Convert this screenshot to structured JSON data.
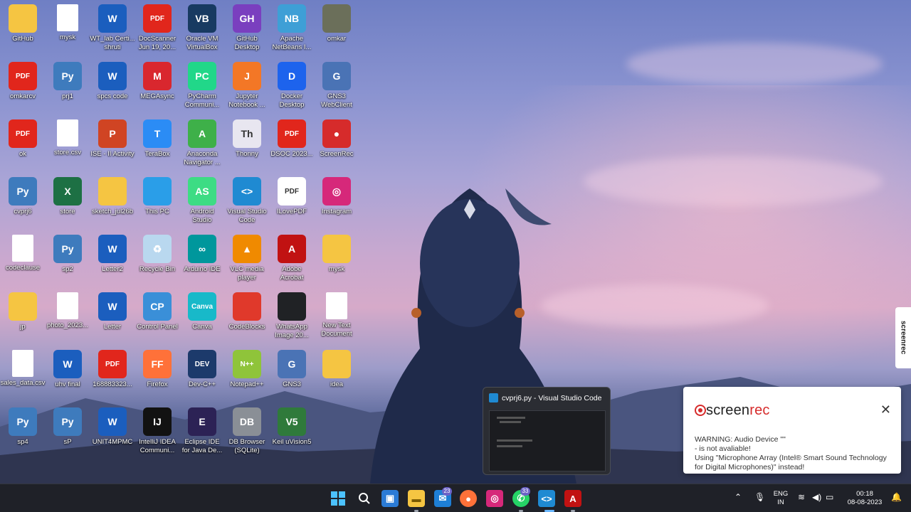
{
  "desktop": {
    "icons": [
      {
        "label": "GitHub",
        "glyph": "",
        "bg": "#f5c542",
        "icon": "folder-icon"
      },
      {
        "label": "mysk",
        "glyph": "",
        "bg": "#ffffff",
        "icon": "blank-file-icon"
      },
      {
        "label": "WT_lab Certi...\nshruti",
        "glyph": "W",
        "bg": "#1b5ebe",
        "icon": "word-icon"
      },
      {
        "label": "DocScanner\nJun 19, 20...",
        "glyph": "PDF",
        "bg": "#e1261c",
        "icon": "pdf-icon"
      },
      {
        "label": "Oracle VM\nVirtualBox",
        "glyph": "VB",
        "bg": "#183a61",
        "icon": "virtualbox-icon"
      },
      {
        "label": "GitHub\nDesktop",
        "glyph": "GH",
        "bg": "#7a3fbf",
        "icon": "github-desktop-icon"
      },
      {
        "label": "Apache\nNetBeans I...",
        "glyph": "NB",
        "bg": "#3e9fd6",
        "icon": "netbeans-icon"
      },
      {
        "label": "omkar",
        "glyph": "",
        "bg": "#6b6f5a",
        "icon": "photo-icon"
      },
      {
        "label": "omkarcv",
        "glyph": "PDF",
        "bg": "#e1261c",
        "icon": "pdf-icon"
      },
      {
        "label": "prj1",
        "glyph": "Py",
        "bg": "#3e7bbd",
        "icon": "python-file-icon"
      },
      {
        "label": "spcs code",
        "glyph": "W",
        "bg": "#1b5ebe",
        "icon": "word-icon"
      },
      {
        "label": "MEGAsync",
        "glyph": "M",
        "bg": "#d9272e",
        "icon": "mega-icon"
      },
      {
        "label": "PyCharm\nCommuni...",
        "glyph": "PC",
        "bg": "#21d789",
        "icon": "pycharm-icon"
      },
      {
        "label": "Jupyter\nNotebook ...",
        "glyph": "J",
        "bg": "#f37726",
        "icon": "jupyter-icon"
      },
      {
        "label": "Docker\nDesktop",
        "glyph": "D",
        "bg": "#1d63ed",
        "icon": "docker-icon"
      },
      {
        "label": "GNS3\nWebClient",
        "glyph": "G",
        "bg": "#4a73b5",
        "icon": "gns3-icon"
      },
      {
        "label": "ok",
        "glyph": "PDF",
        "bg": "#e1261c",
        "icon": "pdf-icon"
      },
      {
        "label": "store.csv",
        "glyph": "",
        "bg": "#ffffff",
        "icon": "text-file-icon"
      },
      {
        "label": "ISE - II Activity",
        "glyph": "P",
        "bg": "#d04423",
        "icon": "powerpoint-icon"
      },
      {
        "label": "TeraBox",
        "glyph": "T",
        "bg": "#2b8cf5",
        "icon": "terabox-icon"
      },
      {
        "label": "Anaconda\nNavigator ...",
        "glyph": "A",
        "bg": "#3eb049",
        "icon": "anaconda-icon"
      },
      {
        "label": "Thonny",
        "glyph": "Th",
        "bg": "#e8e6f0",
        "icon": "thonny-icon"
      },
      {
        "label": "DSOC 2023...",
        "glyph": "PDF",
        "bg": "#e1261c",
        "icon": "pdf-icon"
      },
      {
        "label": "ScreenRec",
        "glyph": "●",
        "bg": "#d62b2b",
        "icon": "screenrec-icon"
      },
      {
        "label": "cvprj6",
        "glyph": "Py",
        "bg": "#3e7bbd",
        "icon": "python-file-icon"
      },
      {
        "label": "store",
        "glyph": "X",
        "bg": "#1d7044",
        "icon": "excel-icon"
      },
      {
        "label": "sketch_jul26b",
        "glyph": "",
        "bg": "#f5c542",
        "icon": "folder-icon"
      },
      {
        "label": "This PC",
        "glyph": "",
        "bg": "#2a9ee8",
        "icon": "monitor-icon"
      },
      {
        "label": "Android\nStudio",
        "glyph": "AS",
        "bg": "#3ddc84",
        "icon": "android-studio-icon"
      },
      {
        "label": "Visual Studio\nCode",
        "glyph": "<>",
        "bg": "#1f8ad2",
        "icon": "vscode-icon"
      },
      {
        "label": "ILovePDF",
        "glyph": "PDF",
        "bg": "#ffffff",
        "icon": "ilovepdf-icon"
      },
      {
        "label": "Instagram",
        "glyph": "◎",
        "bg": "#d6287a",
        "icon": "instagram-icon"
      },
      {
        "label": "codeclause",
        "glyph": "",
        "bg": "#ffffff",
        "icon": "document-icon"
      },
      {
        "label": "sp2",
        "glyph": "Py",
        "bg": "#3e7bbd",
        "icon": "python-file-icon"
      },
      {
        "label": "Letter2",
        "glyph": "W",
        "bg": "#1b5ebe",
        "icon": "word-icon"
      },
      {
        "label": "Recycle Bin",
        "glyph": "♻",
        "bg": "#b9d8ef",
        "icon": "recycle-bin-icon"
      },
      {
        "label": "Arduino IDE",
        "glyph": "∞",
        "bg": "#00979c",
        "icon": "arduino-icon"
      },
      {
        "label": "VLC media\nplayer",
        "glyph": "▲",
        "bg": "#f08a00",
        "icon": "vlc-icon"
      },
      {
        "label": "Adobe\nAcrobat",
        "glyph": "A",
        "bg": "#c11212",
        "icon": "acrobat-icon"
      },
      {
        "label": "mysk",
        "glyph": "",
        "bg": "#f5c542",
        "icon": "folder-icon"
      },
      {
        "label": "jp",
        "glyph": "",
        "bg": "#f5c542",
        "icon": "folder-icon"
      },
      {
        "label": "photo_2023...",
        "glyph": "",
        "bg": "#ffffff",
        "icon": "document-icon"
      },
      {
        "label": "Letter",
        "glyph": "W",
        "bg": "#1b5ebe",
        "icon": "word-icon"
      },
      {
        "label": "Control Panel",
        "glyph": "CP",
        "bg": "#3a8fd8",
        "icon": "control-panel-icon"
      },
      {
        "label": "Canva",
        "glyph": "Canva",
        "bg": "#18b9c9",
        "icon": "canva-icon"
      },
      {
        "label": "CodeBlocks",
        "glyph": "",
        "bg": "#e0392b",
        "icon": "codeblocks-icon"
      },
      {
        "label": "WhatsApp\nImage 20...",
        "glyph": "",
        "bg": "#202225",
        "icon": "image-file-icon"
      },
      {
        "label": "New Text\nDocument",
        "glyph": "",
        "bg": "#ffffff",
        "icon": "text-file-icon"
      },
      {
        "label": "sales_data.csv",
        "glyph": "",
        "bg": "#ffffff",
        "icon": "blank-file-icon"
      },
      {
        "label": "uhv final",
        "glyph": "W",
        "bg": "#1b5ebe",
        "icon": "word-icon"
      },
      {
        "label": "168883323...",
        "glyph": "PDF",
        "bg": "#e1261c",
        "icon": "pdf-icon"
      },
      {
        "label": "Firefox",
        "glyph": "FF",
        "bg": "#ff7139",
        "icon": "firefox-icon"
      },
      {
        "label": "Dev-C++",
        "glyph": "DEV",
        "bg": "#1c3a6b",
        "icon": "devcpp-icon"
      },
      {
        "label": "Notepad++",
        "glyph": "N++",
        "bg": "#8fc43a",
        "icon": "notepadpp-icon"
      },
      {
        "label": "GNS3",
        "glyph": "G",
        "bg": "#4a73b5",
        "icon": "gns3-icon"
      },
      {
        "label": "idea",
        "glyph": "",
        "bg": "#f5c542",
        "icon": "folder-icon"
      },
      {
        "label": "sp4",
        "glyph": "Py",
        "bg": "#3e7bbd",
        "icon": "python-file-icon"
      },
      {
        "label": "sP",
        "glyph": "Py",
        "bg": "#3e7bbd",
        "icon": "python-file-icon"
      },
      {
        "label": "UNIT4MPMC",
        "glyph": "W",
        "bg": "#1b5ebe",
        "icon": "word-icon"
      },
      {
        "label": "IntelliJ IDEA\nCommuni...",
        "glyph": "IJ",
        "bg": "#121212",
        "icon": "intellij-icon"
      },
      {
        "label": "Eclipse IDE\nfor Java De...",
        "glyph": "E",
        "bg": "#2c2255",
        "icon": "eclipse-icon"
      },
      {
        "label": "DB Browser\n(SQLite)",
        "glyph": "DB",
        "bg": "#8a8f96",
        "icon": "db-browser-icon"
      },
      {
        "label": "Keil uVision5",
        "glyph": "V5",
        "bg": "#2f7a3b",
        "icon": "keil-icon"
      }
    ]
  },
  "preview": {
    "title": "cvprj6.py - Visual Studio Code"
  },
  "notification": {
    "brand_a": "screen",
    "brand_b": "rec",
    "close": "✕",
    "line1": "WARNING: Audio Device \"\"",
    "line2": "- is not avaliable!",
    "line3": "Using \"Microphone Array (Intel® Smart Sound Technology for Digital Microphones)\" instead!"
  },
  "side_tab": {
    "label": "screenrec"
  },
  "taskbar": {
    "mail_badge": "23",
    "whatsapp_badge": "33",
    "language_top": "ENG",
    "language_bottom": "IN",
    "time": "00:18",
    "date": "08-08-2023"
  }
}
